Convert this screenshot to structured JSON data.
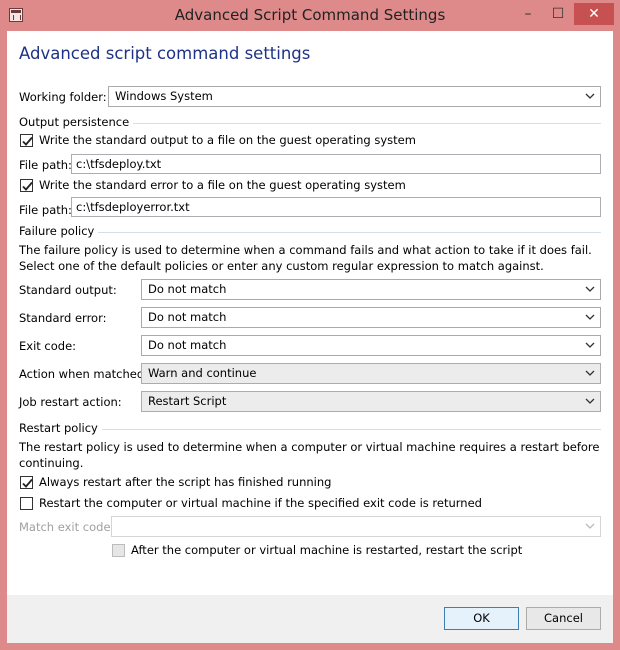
{
  "window": {
    "title": "Advanced Script Command Settings",
    "controls": {
      "minimize": "–",
      "maximize": "☐",
      "close": "✕"
    }
  },
  "heading": "Advanced script command settings",
  "working_folder": {
    "label": "Working folder:",
    "value": "Windows System"
  },
  "output_persistence": {
    "title": "Output persistence",
    "stdout_checkbox": {
      "label": "Write the standard output to a file on the guest operating system",
      "checked": true
    },
    "stdout_path": {
      "label": "File path:",
      "value": "c:\\tfsdeploy.txt"
    },
    "stderr_checkbox": {
      "label": "Write the standard error to a file on the guest operating system",
      "checked": true
    },
    "stderr_path": {
      "label": "File path:",
      "value": "c:\\tfsdeployerror.txt"
    }
  },
  "failure_policy": {
    "title": "Failure policy",
    "description": "The failure policy is used to determine when a command fails and what action to take if it does fail. Select one of the default policies or enter any custom regular expression to match against.",
    "standard_output": {
      "label": "Standard output:",
      "value": "Do not match"
    },
    "standard_error": {
      "label": "Standard error:",
      "value": "Do not match"
    },
    "exit_code": {
      "label": "Exit code:",
      "value": "Do not match"
    },
    "action_when_matched": {
      "label": "Action when matched:",
      "value": "Warn and continue"
    },
    "job_restart_action": {
      "label": "Job restart action:",
      "value": "Restart Script"
    }
  },
  "restart_policy": {
    "title": "Restart policy",
    "description": "The restart policy is used to determine when a computer or virtual machine requires a restart before continuing.",
    "always_restart": {
      "label": "Always restart after the script has finished running",
      "checked": true
    },
    "restart_on_exit_code": {
      "label": "Restart the computer or virtual machine if the specified exit code is returned",
      "checked": false
    },
    "match_exit_code": {
      "label": "Match exit code:",
      "value": ""
    },
    "restart_script": {
      "label": "After the computer or virtual machine is restarted, restart the script",
      "checked": false,
      "enabled": false
    }
  },
  "buttons": {
    "ok": "OK",
    "cancel": "Cancel"
  },
  "colors": {
    "window_frame": "#de8a8a",
    "heading": "#1e3287",
    "close_button": "#c75050",
    "default_button_border": "#3c7fb1"
  }
}
